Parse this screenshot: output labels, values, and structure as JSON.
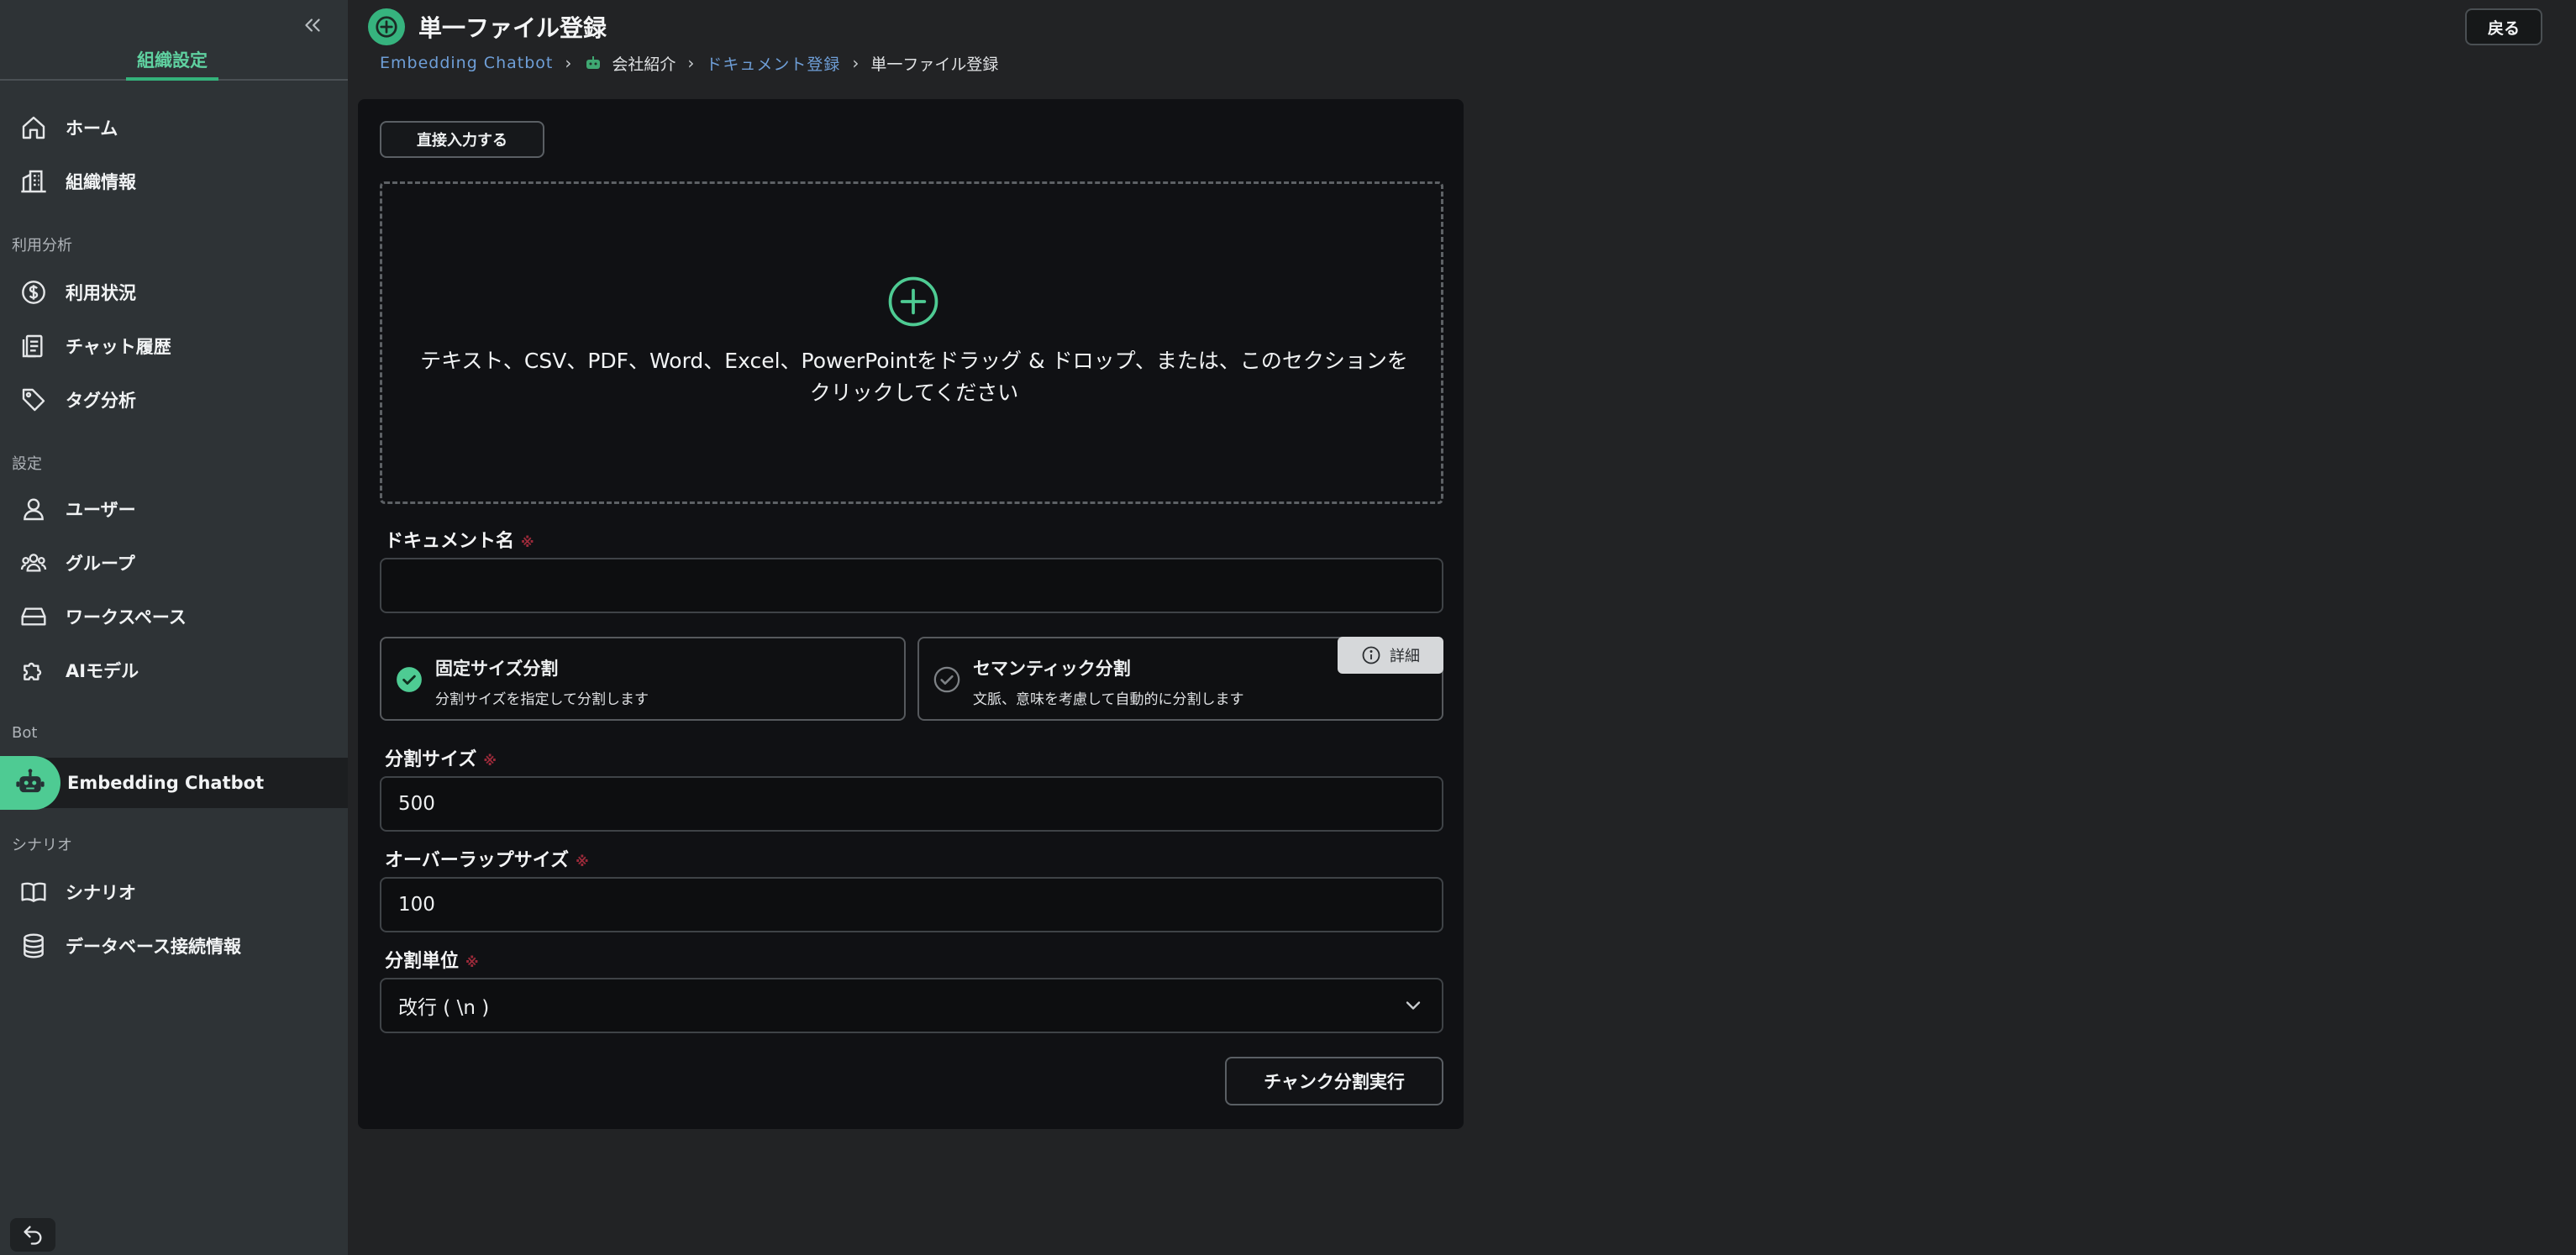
{
  "sidebar": {
    "tab_label": "組織設定",
    "sections": {
      "analytics": "利用分析",
      "settings": "設定",
      "bot": "Bot",
      "scenario": "シナリオ"
    },
    "items": {
      "home": "ホーム",
      "org_info": "組織情報",
      "usage": "利用状況",
      "chat_history": "チャット履歴",
      "tag_analysis": "タグ分析",
      "users": "ユーザー",
      "groups": "グループ",
      "workspace": "ワークスペース",
      "ai_model": "AIモデル",
      "embedding_chatbot": "Embedding Chatbot",
      "scenario": "シナリオ",
      "db_connection": "データベース接続情報"
    }
  },
  "header": {
    "title": "単一ファイル登録",
    "back_label": "戻る",
    "breadcrumb": {
      "c1": "Embedding Chatbot",
      "c2": "会社紹介",
      "c3": "ドキュメント登録",
      "c4": "単一ファイル登録"
    }
  },
  "form": {
    "direct_input_label": "直接入力する",
    "dropzone_text_line1": "テキスト、CSV、PDF、Word、Excel、PowerPointをドラッグ & ドロップ、または、このセクションを",
    "dropzone_text_line2": "クリックしてください",
    "doc_name_label": "ドキュメント名",
    "doc_name_value": "",
    "required_mark": "※",
    "fixed_split": {
      "title": "固定サイズ分割",
      "desc": "分割サイズを指定して分割します",
      "selected": true
    },
    "semantic_split": {
      "title": "セマンティック分割",
      "desc": "文脈、意味を考慮して自動的に分割します",
      "selected": false
    },
    "detail_label": "詳細",
    "split_size_label": "分割サイズ",
    "split_size_value": "500",
    "overlap_label": "オーバーラップサイズ",
    "overlap_value": "100",
    "split_unit_label": "分割単位",
    "split_unit_value": "改行 ( \\n )",
    "execute_label": "チャンク分割実行"
  },
  "colors": {
    "accent": "#36b37e",
    "link": "#6f9fd8",
    "required": "#9b2a3a"
  }
}
